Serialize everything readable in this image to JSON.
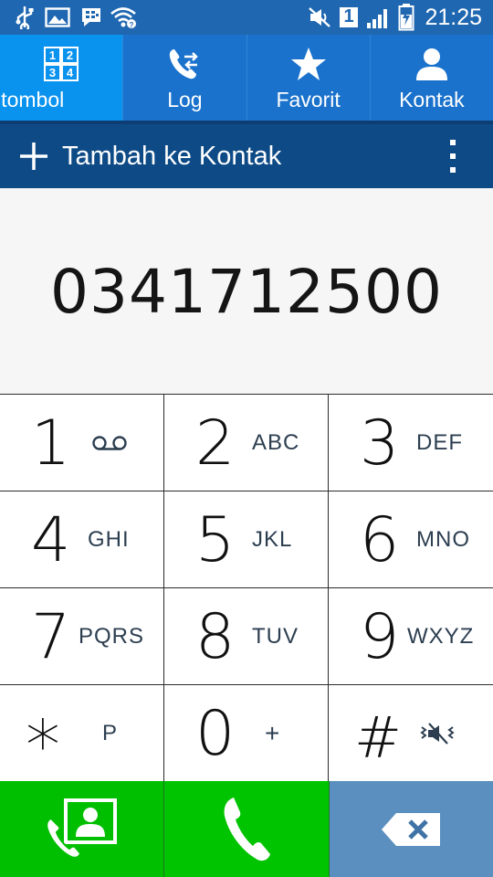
{
  "status_bar": {
    "time": "21:25",
    "sim_slot": "1",
    "icons": [
      "usb-icon",
      "image-icon",
      "bbm-icon",
      "wifi-icon",
      "mute-icon",
      "signal-icon",
      "battery-charging-icon"
    ]
  },
  "tabs": [
    {
      "id": "keypad",
      "label": "n tombol",
      "icon": "keypad-grid-icon",
      "active": true
    },
    {
      "id": "log",
      "label": "Log",
      "icon": "call-log-icon",
      "active": false
    },
    {
      "id": "favorites",
      "label": "Favorit",
      "icon": "star-icon",
      "active": false
    },
    {
      "id": "contacts",
      "label": "Kontak",
      "icon": "person-icon",
      "active": false
    }
  ],
  "action_bar": {
    "add_label": "Tambah ke Kontak"
  },
  "display": {
    "number": "0341712500"
  },
  "keys": [
    {
      "digit": "1",
      "letters": "",
      "sub_icon": "voicemail-icon"
    },
    {
      "digit": "2",
      "letters": "ABC"
    },
    {
      "digit": "3",
      "letters": "DEF"
    },
    {
      "digit": "4",
      "letters": "GHI"
    },
    {
      "digit": "5",
      "letters": "JKL"
    },
    {
      "digit": "6",
      "letters": "MNO"
    },
    {
      "digit": "7",
      "letters": "PQRS"
    },
    {
      "digit": "8",
      "letters": "TUV"
    },
    {
      "digit": "9",
      "letters": "WXYZ"
    },
    {
      "digit": "*",
      "letters": "P"
    },
    {
      "digit": "0",
      "letters": "+"
    },
    {
      "digit": "#",
      "letters": "",
      "sub_icon": "vibrate-mute-icon"
    }
  ],
  "colors": {
    "status_bar": "#1f67b1",
    "tab_bar": "#1a72cc",
    "tab_active": "#0a92ef",
    "action_bar": "#0e4b86",
    "call_green": "#00c400",
    "delete_blue": "#5a8fbf"
  }
}
